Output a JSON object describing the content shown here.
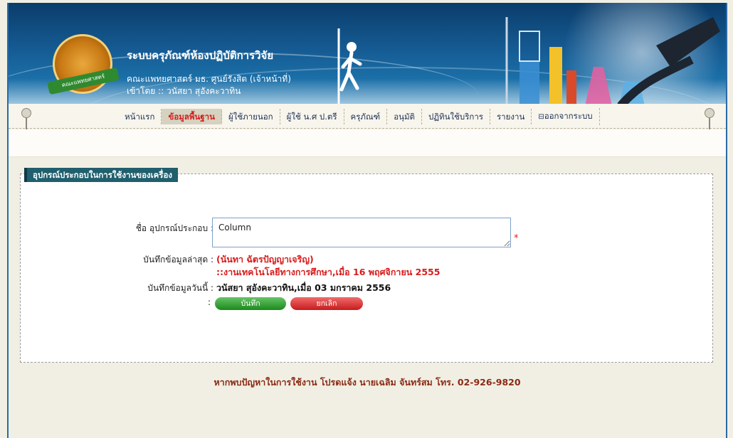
{
  "header": {
    "system_title": "ระบบครุภัณฑ์ห้องปฏิบัติการวิจัย",
    "faculty_line": "คณะแพทยศาสตร์ มธ. ศูนย์รังสิต (เจ้าหน้าที่)",
    "login_line": "เข้าโดย :: วนัสยา สุอังคะวาทิน",
    "logo_text": "คณะแพทยศาสตร์"
  },
  "menu": {
    "items": [
      {
        "label": "หน้าแรก"
      },
      {
        "label": "ข้อมูลพื้นฐาน"
      },
      {
        "label": "ผู้ใช้ภายนอก"
      },
      {
        "label": "ผู้ใช้ น.ศ ป.ตรี"
      },
      {
        "label": "ครุภัณฑ์"
      },
      {
        "label": "อนุมัติ"
      },
      {
        "label": "ปฏิทินใช้บริการ"
      },
      {
        "label": "รายงาน"
      },
      {
        "label": "ออกจากระบบ"
      }
    ],
    "active_index": 1
  },
  "form": {
    "section_title": "อุปกรณ์ประกอบในการใช้งานของเครื่อง",
    "equipment_label": "ชื่อ อุปกรณ์ประกอบ :",
    "equipment_value": "Column",
    "required_mark": "*",
    "last_record_label": "บันทึกข้อมูลล่าสุด :",
    "last_record_line1": "(นันทา ฉัตรปัญญาเจริญ)",
    "last_record_line2": "::งานเทคโนโลยีทางการศึกษา,เมื่อ 16 พฤศจิกายน 2555",
    "today_label": "บันทึกข้อมูลวันนี้ :",
    "today_value": "วนัสยา สุอังคะวาทิน,เมื่อ 03 มกราคม 2556",
    "buttons_colon": ":",
    "save_label": "บันทึก",
    "cancel_label": "ยกเลิก"
  },
  "footer": {
    "text": "หากพบปัญหาในการใช้งาน โปรดแจ้ง นายเฉลิม จันทร์สม โทร. 02-926-9820"
  },
  "colors": {
    "banner": "#155a92",
    "active_menu": "#d41c1c",
    "section_title_bg": "#1f5f6e",
    "save_button": "#1b8a1b",
    "cancel_button": "#c61c1c",
    "footer_text": "#8a2a14"
  }
}
